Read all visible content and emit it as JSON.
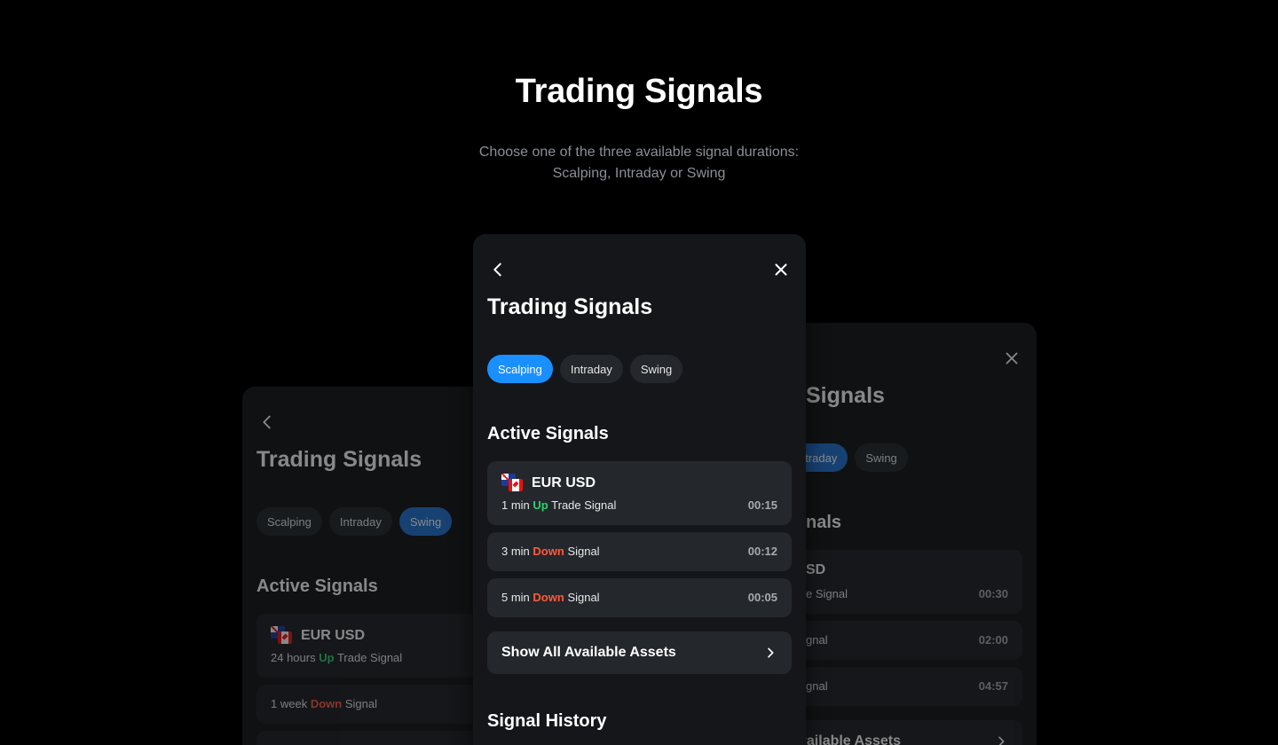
{
  "hero": {
    "title": "Trading Signals",
    "subtitle_line1": "Choose one of the three available signal durations:",
    "subtitle_line2": "Scalping, Intraday or Swing"
  },
  "center_panel": {
    "title": "Trading Signals",
    "tabs": [
      {
        "label": "Scalping",
        "active": true
      },
      {
        "label": "Intraday",
        "active": false
      },
      {
        "label": "Swing",
        "active": false
      }
    ],
    "active_section": "Active Signals",
    "asset": "EUR USD",
    "signals": [
      {
        "duration": "1 min",
        "direction": "Up",
        "suffix": "Trade Signal",
        "time": "00:15"
      },
      {
        "duration": "3 min",
        "direction": "Down",
        "suffix": "Signal",
        "time": "00:12"
      },
      {
        "duration": "5 min",
        "direction": "Down",
        "suffix": "Signal",
        "time": "00:05"
      }
    ],
    "show_all": "Show All Available Assets",
    "history_section": "Signal History"
  },
  "left_panel": {
    "title": "Trading Signals",
    "tabs": [
      {
        "label": "Scalping",
        "active": false
      },
      {
        "label": "Intraday",
        "active": false
      },
      {
        "label": "Swing",
        "active": true
      }
    ],
    "active_section": "Active Signals",
    "asset": "EUR USD",
    "signals": [
      {
        "duration": "24 hours",
        "direction": "Up",
        "suffix": "Trade Signal"
      },
      {
        "duration": "1 week",
        "direction": "Down",
        "suffix": "Signal"
      }
    ]
  },
  "right_panel": {
    "title_visible": "Signals",
    "tabs": [
      {
        "label": "ntraday",
        "active": true
      },
      {
        "label": "Swing",
        "active": false
      }
    ],
    "section_visible": "nals",
    "asset_visible": "SD",
    "signals": [
      {
        "text_visible": "e Signal",
        "time": "00:30"
      },
      {
        "text_visible": "gnal",
        "time": "02:00"
      },
      {
        "text_visible": "gnal",
        "time": "04:57"
      }
    ],
    "show_all_visible": "vailable Assets"
  },
  "colors": {
    "accent": "#1a8fff",
    "up": "#2fd16f",
    "down": "#ff5a3c",
    "panel": "#141619",
    "card": "#24272b"
  },
  "icons": {
    "back": "chevron-left-icon",
    "close": "close-icon",
    "forward": "chevron-right-icon",
    "flag": "eur-usd-flag-icon"
  }
}
